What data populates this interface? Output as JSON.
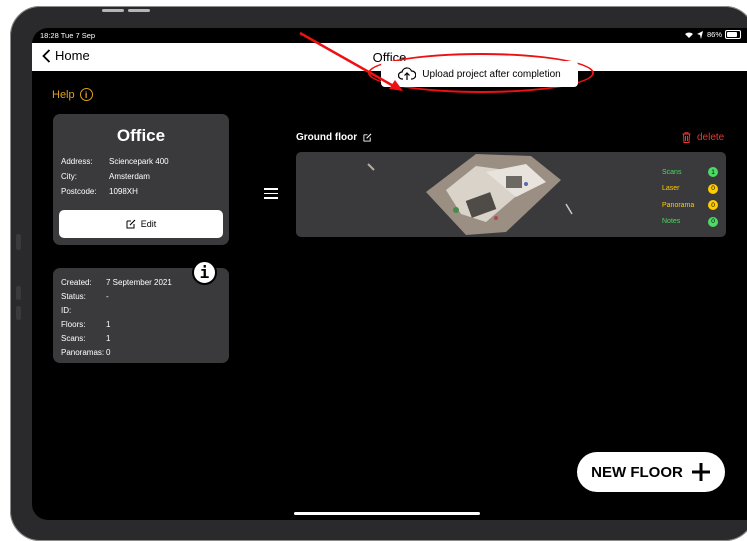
{
  "status": {
    "time": "18:28",
    "date": "Tue 7 Sep",
    "battery": "86%"
  },
  "nav": {
    "back_label": "Home",
    "title": "Office"
  },
  "help": {
    "label": "Help"
  },
  "upload": {
    "label": "Upload project after completion"
  },
  "project": {
    "name": "Office",
    "fields": [
      {
        "key": "Address:",
        "value": "Sciencepark 400"
      },
      {
        "key": "City:",
        "value": "Amsterdam"
      },
      {
        "key": "Postcode:",
        "value": "1098XH"
      }
    ],
    "edit_label": "Edit"
  },
  "meta": [
    {
      "key": "Created:",
      "value": "7 September 2021"
    },
    {
      "key": "Status:",
      "value": "-"
    },
    {
      "key": "ID:",
      "value": ""
    },
    {
      "key": "Floors:",
      "value": "1"
    },
    {
      "key": "Scans:",
      "value": "1"
    },
    {
      "key": "Panoramas:",
      "value": "0"
    }
  ],
  "floor": {
    "name": "Ground floor",
    "delete_label": "delete",
    "stats": [
      {
        "label": "Scans",
        "count": "1",
        "color": "#4cd964",
        "label_color": "#4cd964"
      },
      {
        "label": "Laser",
        "count": "0",
        "color": "#ffcc00",
        "label_color": "#ffcc00"
      },
      {
        "label": "Panorama",
        "count": "0",
        "color": "#ffcc00",
        "label_color": "#ffcc00"
      },
      {
        "label": "Notes",
        "count": "0",
        "color": "#4cd964",
        "label_color": "#4cd964"
      }
    ]
  },
  "new_floor": {
    "label": "NEW FLOOR"
  },
  "colors": {
    "accent": "#e0a020",
    "danger": "#e33333",
    "annotation": "#e11111"
  }
}
